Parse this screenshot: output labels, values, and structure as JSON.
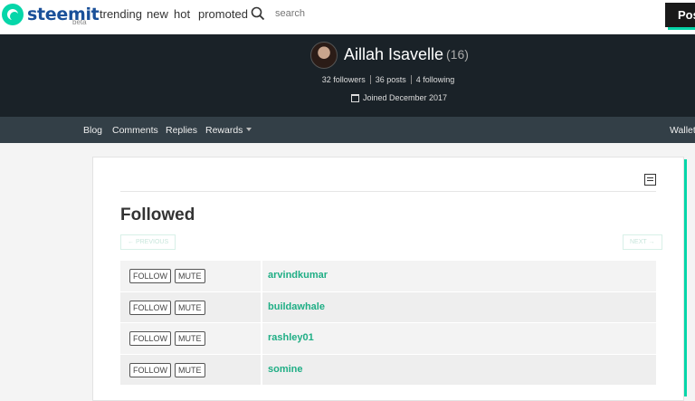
{
  "header": {
    "logo_text": "steemit",
    "logo_badge": "beta",
    "nav": [
      "trending",
      "new",
      "hot",
      "promoted"
    ],
    "search_placeholder": "search",
    "post_label": "Pos"
  },
  "profile": {
    "name": "Aillah Isavelle",
    "reputation": "(16)",
    "followers": "32 followers",
    "posts": "36 posts",
    "following": "4 following",
    "joined": "Joined December 2017"
  },
  "subnav": {
    "items": [
      "Blog",
      "Comments",
      "Replies",
      "Rewards"
    ],
    "wallet": "Wallet"
  },
  "content": {
    "title": "Followed",
    "previous_label": "← PREVIOUS",
    "next_label": "NEXT →",
    "follow_label": "FOLLOW",
    "mute_label": "MUTE",
    "users": [
      "arvindkumar",
      "buildawhale",
      "rashley01",
      "somine"
    ]
  },
  "colors": {
    "accent": "#06d6a9",
    "brand": "#1a5099",
    "username": "#1fae85",
    "banner": "#1a2228",
    "subnav": "#333f47"
  }
}
